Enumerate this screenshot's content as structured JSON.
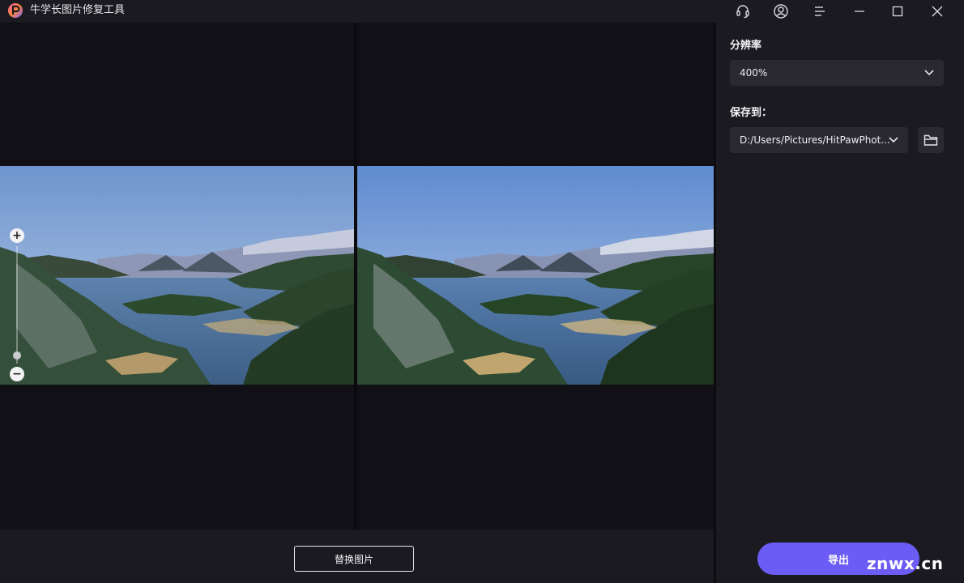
{
  "titlebar": {
    "app_title": "牛学长图片修复工具",
    "icons": [
      "headset-icon",
      "user-icon",
      "menu-icon",
      "minimize-icon",
      "maximize-icon",
      "close-icon"
    ]
  },
  "canvas": {
    "zoom_plus": "+",
    "zoom_minus": "−",
    "zoom_level": 0.1
  },
  "bottom": {
    "replace_label": "替换图片"
  },
  "sidebar": {
    "resolution_label": "分辨率",
    "resolution_value": "400%",
    "save_label": "保存到：",
    "save_path": "D:/Users/Pictures/HitPawPhot...",
    "export_label": "导出"
  },
  "watermark": "znwx.cn",
  "colors": {
    "accent": "#6a5cf4",
    "panel": "#1b1a20",
    "canvas": "#111016"
  }
}
